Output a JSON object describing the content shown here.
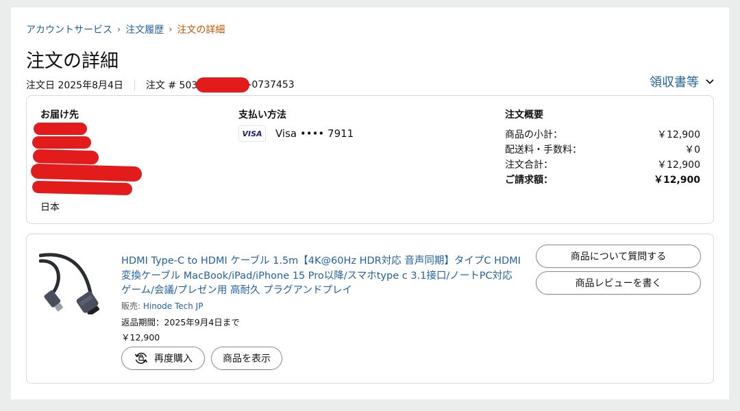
{
  "breadcrumb": {
    "item1": "アカウントサービス",
    "item2": "注文履歴",
    "current": "注文の詳細",
    "separator": "›"
  },
  "page_title": "注文の詳細",
  "order_meta": {
    "order_date": "注文日 2025年8月4日",
    "order_number_prefix": "注文 # 503",
    "order_number_suffix": "-0737453"
  },
  "receipt_label": "領収書等",
  "shipping": {
    "heading": "お届け先",
    "country": "日本"
  },
  "payment": {
    "heading": "支払い方法",
    "card_logo": "VISA",
    "card_text": "Visa •••• 7911"
  },
  "summary": {
    "heading": "注文概要",
    "rows": [
      {
        "label": "商品の小計：",
        "value": "￥12,900"
      },
      {
        "label": "配送料・手数料：",
        "value": "￥0"
      },
      {
        "label": "注文合計：",
        "value": "￥12,900"
      },
      {
        "label": "ご請求額：",
        "value": "￥12,900"
      }
    ]
  },
  "item": {
    "title": "HDMI Type-C to HDMI ケーブル 1.5m【4K@60Hz HDR対応 音声同期】タイプC HDMI変換ケーブル MacBook/iPad/iPhone 15 Pro以降/スマホtype c 3.1接口/ノートPC対応 ゲーム/会議/プレゼン用 高耐久 プラグアンドプレイ",
    "seller_label": "販売: ",
    "seller_name": "Hinode Tech JP",
    "return_window": "返品期間：2025年9月4日まで",
    "price": "￥12,900",
    "buy_again": "再度購入",
    "view_item": "商品を表示",
    "ask_question": "商品について質問する",
    "write_review": "商品レビューを書く"
  },
  "colors": {
    "link": "#2162a1",
    "breadcrumb_current": "#c45500",
    "redaction": "#e31b1b",
    "border": "#d5d9d9"
  }
}
